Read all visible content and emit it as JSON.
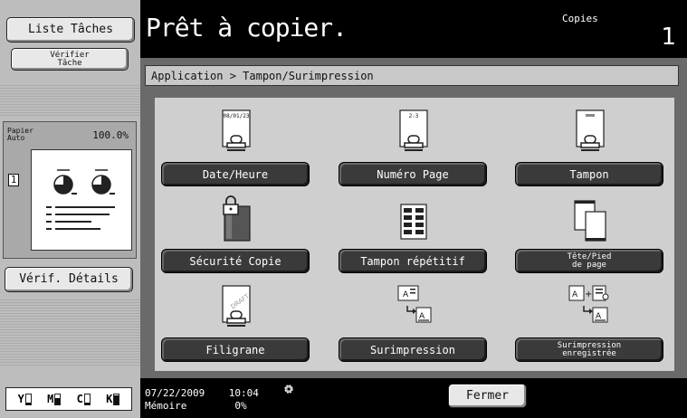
{
  "left": {
    "liste_taches": "Liste Tâches",
    "verifier_tache": "Vérifier\nTâche",
    "paper_label": "Papier\nAuto",
    "zoom": "100.0%",
    "page_indicator": "1",
    "verif_details": "Vérif. Détails",
    "toner": [
      {
        "label": "Y",
        "level": 0.2
      },
      {
        "label": "M",
        "level": 0.6
      },
      {
        "label": "C",
        "level": 0.2
      },
      {
        "label": "K",
        "level": 0.9
      }
    ]
  },
  "header": {
    "status": "Prêt à copier.",
    "copies_label": "Copies",
    "copies_value": "1"
  },
  "breadcrumb": "Application > Tampon/Surimpression",
  "functions": [
    {
      "label": "Date/Heure",
      "icon": "date-stamp-icon",
      "icon_text": "08/01/23"
    },
    {
      "label": "Numéro Page",
      "icon": "page-number-stamp-icon",
      "icon_text": "2-3"
    },
    {
      "label": "Tampon",
      "icon": "stamp-icon"
    },
    {
      "label": "Sécurité Copie",
      "icon": "copy-security-icon"
    },
    {
      "label": "Tampon répétitif",
      "icon": "repeat-stamp-icon"
    },
    {
      "label": "Tête/Pied\nde page",
      "icon": "header-footer-icon"
    },
    {
      "label": "Filigrane",
      "icon": "watermark-icon",
      "icon_text": "DRAFT"
    },
    {
      "label": "Surimpression",
      "icon": "overlay-icon"
    },
    {
      "label": "Surimpression\nenregistrée",
      "icon": "registered-overlay-icon"
    }
  ],
  "footer": {
    "date": "07/22/2009    10:04",
    "memory": "Mémoire        0%",
    "fermer": "Fermer"
  }
}
